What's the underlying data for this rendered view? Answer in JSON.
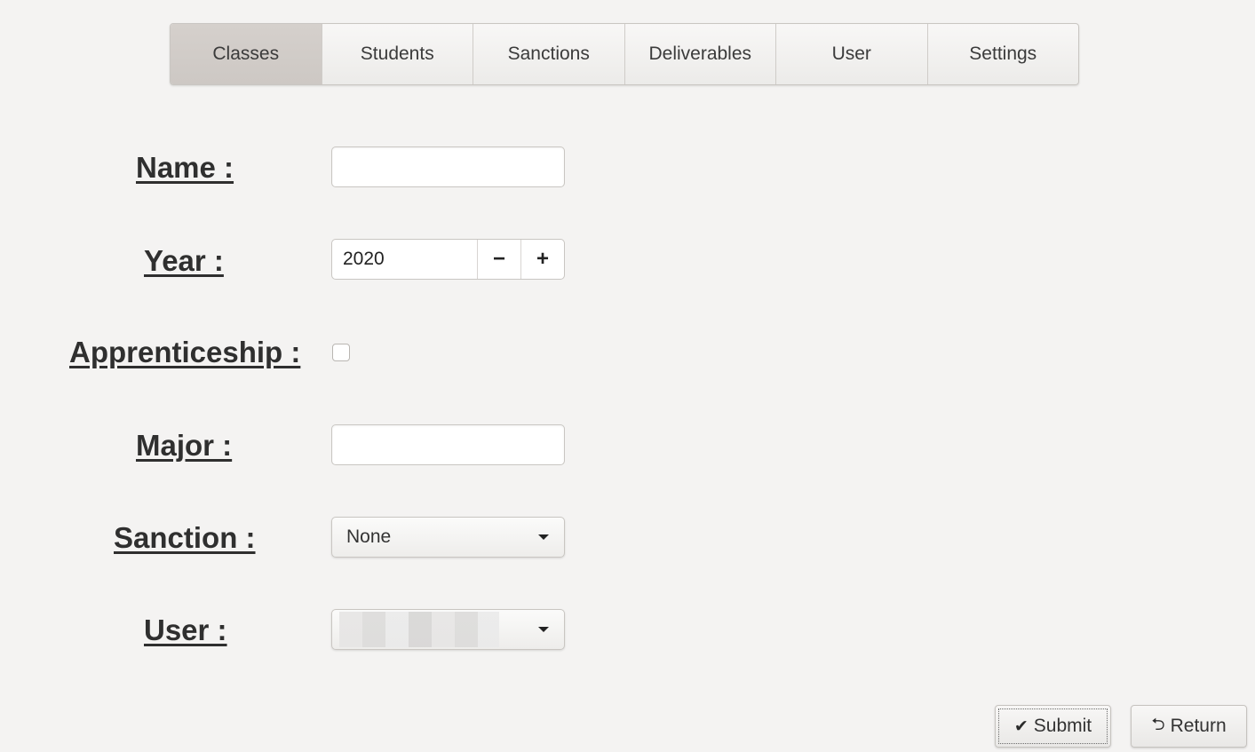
{
  "tabs": [
    {
      "label": "Classes",
      "active": true
    },
    {
      "label": "Students",
      "active": false
    },
    {
      "label": "Sanctions",
      "active": false
    },
    {
      "label": "Deliverables",
      "active": false
    },
    {
      "label": "User",
      "active": false
    },
    {
      "label": "Settings",
      "active": false
    }
  ],
  "form": {
    "name_label": "Name :",
    "name_value": "",
    "year_label": "Year :",
    "year_value": "2020",
    "year_decrement": "−",
    "year_increment": "+",
    "apprenticeship_label": "Apprenticeship :",
    "apprenticeship_checked": false,
    "major_label": "Major :",
    "major_value": "",
    "sanction_label": "Sanction :",
    "sanction_selected": "None",
    "user_label": "User :",
    "user_selected": ""
  },
  "actions": {
    "submit_icon": "✔",
    "submit_label": "Submit",
    "return_icon": "⮌",
    "return_label": "Return"
  },
  "colors": {
    "background": "#f4f3f2",
    "active_tab": "#d0cbc7",
    "text": "#2f2f2f"
  }
}
